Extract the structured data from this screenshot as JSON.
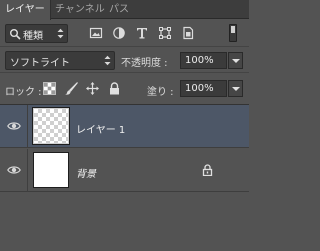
{
  "tabs": [
    {
      "label": "レイヤー"
    },
    {
      "label": "チャンネル"
    },
    {
      "label": "パス"
    }
  ],
  "filter": {
    "kind_label": "種類",
    "icons": [
      "image-filter-icon",
      "adjustment-filter-icon",
      "type-filter-icon",
      "shape-filter-icon",
      "smart-object-filter-icon"
    ]
  },
  "blend": {
    "mode": "ソフトライト",
    "opacity_label": "不透明度 :",
    "opacity_value": "100%"
  },
  "lock": {
    "label": "ロック :",
    "icons": [
      "lock-transparent-icon",
      "lock-image-icon",
      "lock-position-icon",
      "lock-all-icon"
    ],
    "fill_label": "塗り :",
    "fill_value": "100%"
  },
  "layers": [
    {
      "name": "レイヤー 1",
      "selected": true,
      "visible": true,
      "locked": false,
      "thumb": "transparent"
    },
    {
      "name": "背景",
      "selected": false,
      "visible": true,
      "locked": true,
      "thumb": "white"
    }
  ],
  "colors": {
    "panel_bg": "#535353",
    "selected_row": "#4d5767",
    "tab_bar": "#3d3d3d"
  }
}
